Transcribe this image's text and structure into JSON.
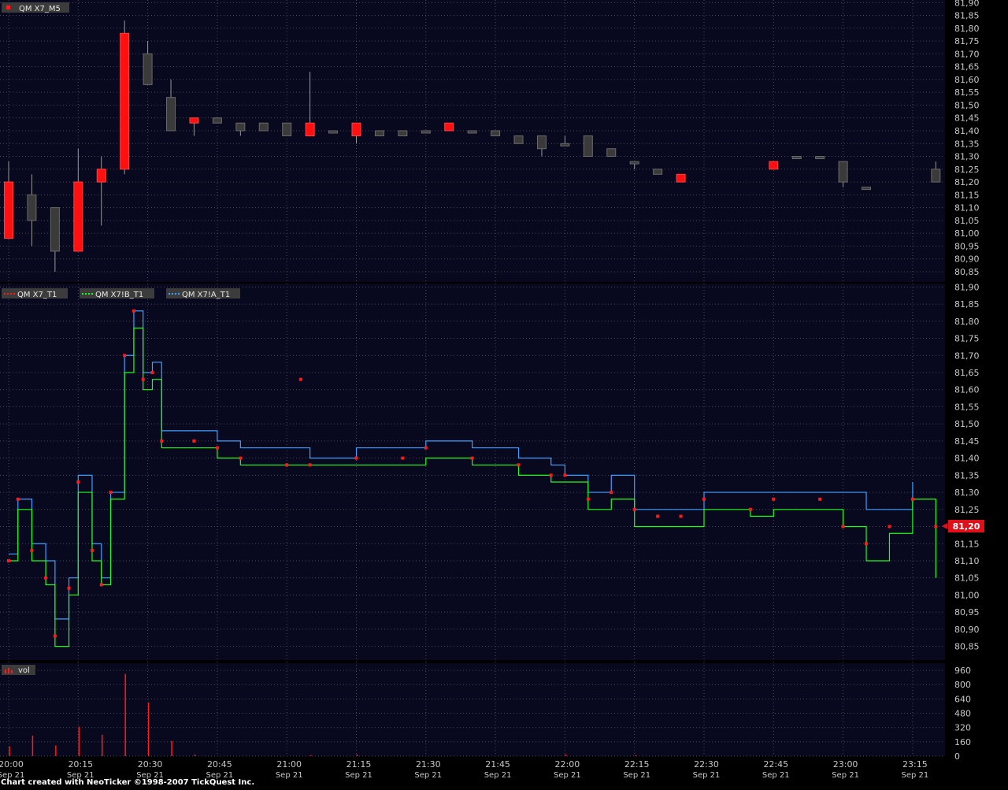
{
  "colors": {
    "background": "#000000",
    "panel": "#08081e",
    "grid": "#4a4a5a",
    "axis_text": "#c8c8c8",
    "up_candle": "#3a3a3a",
    "down_candle": "#ff1010",
    "wick": "#9a9a9a",
    "trade": "#ff1a1a",
    "bid": "#1cff1c",
    "ask": "#3ea0ff",
    "volume": "#ff1a1a",
    "price_marker": "#e0101a"
  },
  "footer": "Chart created with NeoTicker ©1998-2007 TickQuest Inc.",
  "price_marker": {
    "value": "81,20"
  },
  "legends": {
    "candles": "QM X7_M5",
    "trade": "QM X7_T1",
    "bid": "QM X7!B_T1",
    "ask": "QM X7!A_T1",
    "volume": "vol"
  },
  "chart_data": [
    {
      "type": "candlestick",
      "series_name": "QM X7_M5",
      "ylim": [
        80.81,
        81.91
      ],
      "yticks": [
        "81,90",
        "81,85",
        "81,80",
        "81,75",
        "81,70",
        "81,65",
        "81,60",
        "81,55",
        "81,50",
        "81,45",
        "81,40",
        "81,35",
        "81,30",
        "81,25",
        "81,20",
        "81,15",
        "81,10",
        "81,05",
        "81,00",
        "80,95",
        "80,90",
        "80,85"
      ],
      "candles": [
        {
          "t": "20:00",
          "o": 81.2,
          "h": 81.28,
          "l": 80.98,
          "c": 80.98
        },
        {
          "t": "20:05",
          "o": 81.05,
          "h": 81.23,
          "l": 80.95,
          "c": 81.15
        },
        {
          "t": "20:10",
          "o": 80.93,
          "h": 81.1,
          "l": 80.85,
          "c": 81.1
        },
        {
          "t": "20:15",
          "o": 81.2,
          "h": 81.33,
          "l": 80.93,
          "c": 80.93
        },
        {
          "t": "20:20",
          "o": 81.25,
          "h": 81.3,
          "l": 81.03,
          "c": 81.2
        },
        {
          "t": "20:25",
          "o": 81.78,
          "h": 81.83,
          "l": 81.23,
          "c": 81.25
        },
        {
          "t": "20:30",
          "o": 81.58,
          "h": 81.75,
          "l": 81.58,
          "c": 81.7
        },
        {
          "t": "20:35",
          "o": 81.4,
          "h": 81.6,
          "l": 81.4,
          "c": 81.53
        },
        {
          "t": "20:40",
          "o": 81.45,
          "h": 81.45,
          "l": 81.38,
          "c": 81.43
        },
        {
          "t": "20:45",
          "o": 81.43,
          "h": 81.45,
          "l": 81.43,
          "c": 81.45
        },
        {
          "t": "20:50",
          "o": 81.4,
          "h": 81.43,
          "l": 81.38,
          "c": 81.43
        },
        {
          "t": "20:55",
          "o": 81.4,
          "h": 81.43,
          "l": 81.4,
          "c": 81.43
        },
        {
          "t": "21:00",
          "o": 81.38,
          "h": 81.43,
          "l": 81.38,
          "c": 81.43
        },
        {
          "t": "21:05",
          "o": 81.43,
          "h": 81.63,
          "l": 81.38,
          "c": 81.38
        },
        {
          "t": "21:10",
          "o": 81.4,
          "h": 81.4,
          "l": 81.4,
          "c": 81.4
        },
        {
          "t": "21:15",
          "o": 81.43,
          "h": 81.43,
          "l": 81.35,
          "c": 81.38
        },
        {
          "t": "21:20",
          "o": 81.38,
          "h": 81.4,
          "l": 81.38,
          "c": 81.4
        },
        {
          "t": "21:25",
          "o": 81.38,
          "h": 81.4,
          "l": 81.38,
          "c": 81.4
        },
        {
          "t": "21:30",
          "o": 81.4,
          "h": 81.4,
          "l": 81.4,
          "c": 81.4
        },
        {
          "t": "21:35",
          "o": 81.43,
          "h": 81.43,
          "l": 81.4,
          "c": 81.4
        },
        {
          "t": "21:40",
          "o": 81.4,
          "h": 81.4,
          "l": 81.4,
          "c": 81.4
        },
        {
          "t": "21:45",
          "o": 81.38,
          "h": 81.4,
          "l": 81.38,
          "c": 81.4
        },
        {
          "t": "21:50",
          "o": 81.35,
          "h": 81.38,
          "l": 81.35,
          "c": 81.38
        },
        {
          "t": "21:55",
          "o": 81.33,
          "h": 81.38,
          "l": 81.3,
          "c": 81.38
        },
        {
          "t": "22:00",
          "o": 81.35,
          "h": 81.38,
          "l": 81.35,
          "c": 81.35
        },
        {
          "t": "22:05",
          "o": 81.3,
          "h": 81.38,
          "l": 81.3,
          "c": 81.38
        },
        {
          "t": "22:10",
          "o": 81.3,
          "h": 81.33,
          "l": 81.3,
          "c": 81.33
        },
        {
          "t": "22:15",
          "o": 81.28,
          "h": 81.28,
          "l": 81.25,
          "c": 81.28
        },
        {
          "t": "22:20",
          "o": 81.23,
          "h": 81.25,
          "l": 81.23,
          "c": 81.25
        },
        {
          "t": "22:25",
          "o": 81.23,
          "h": 81.23,
          "l": 81.2,
          "c": 81.2
        },
        {
          "t": "22:45",
          "o": 81.28,
          "h": 81.28,
          "l": 81.25,
          "c": 81.25
        },
        {
          "t": "22:50",
          "o": 81.3,
          "h": 81.3,
          "l": 81.3,
          "c": 81.3
        },
        {
          "t": "22:55",
          "o": 81.3,
          "h": 81.3,
          "l": 81.3,
          "c": 81.3
        },
        {
          "t": "23:00",
          "o": 81.2,
          "h": 81.28,
          "l": 81.18,
          "c": 81.28
        },
        {
          "t": "23:05",
          "o": 81.18,
          "h": 81.18,
          "l": 81.18,
          "c": 81.18
        },
        {
          "t": "23:20",
          "o": 81.2,
          "h": 81.28,
          "l": 81.2,
          "c": 81.25
        }
      ]
    },
    {
      "type": "line",
      "ylim": [
        80.81,
        81.91
      ],
      "yticks": [
        "81,90",
        "81,85",
        "81,80",
        "81,75",
        "81,70",
        "81,65",
        "81,60",
        "81,55",
        "81,50",
        "81,45",
        "81,40",
        "81,35",
        "81,30",
        "81,25",
        "81,20",
        "81,15",
        "81,10",
        "81,05",
        "81,00",
        "80,95",
        "80,90",
        "80,85"
      ],
      "series": [
        {
          "name": "QM X7!A_T1",
          "points": [
            [
              "20:00",
              81.12
            ],
            [
              "20:02",
              81.28
            ],
            [
              "20:05",
              81.15
            ],
            [
              "20:08",
              81.1
            ],
            [
              "20:10",
              80.93
            ],
            [
              "20:13",
              81.05
            ],
            [
              "20:15",
              81.35
            ],
            [
              "20:18",
              81.15
            ],
            [
              "20:20",
              81.05
            ],
            [
              "20:22",
              81.3
            ],
            [
              "20:25",
              81.7
            ],
            [
              "20:27",
              81.83
            ],
            [
              "20:29",
              81.65
            ],
            [
              "20:31",
              81.68
            ],
            [
              "20:33",
              81.48
            ],
            [
              "20:40",
              81.48
            ],
            [
              "20:45",
              81.45
            ],
            [
              "20:50",
              81.43
            ],
            [
              "21:00",
              81.43
            ],
            [
              "21:05",
              81.4
            ],
            [
              "21:15",
              81.43
            ],
            [
              "21:25",
              81.43
            ],
            [
              "21:30",
              81.45
            ],
            [
              "21:40",
              81.43
            ],
            [
              "21:50",
              81.4
            ],
            [
              "21:57",
              81.38
            ],
            [
              "22:00",
              81.35
            ],
            [
              "22:05",
              81.3
            ],
            [
              "22:10",
              81.35
            ],
            [
              "22:15",
              81.25
            ],
            [
              "22:20",
              81.25
            ],
            [
              "22:25",
              81.25
            ],
            [
              "22:30",
              81.3
            ],
            [
              "22:40",
              81.3
            ],
            [
              "22:45",
              81.3
            ],
            [
              "22:55",
              81.3
            ],
            [
              "23:00",
              81.3
            ],
            [
              "23:05",
              81.25
            ],
            [
              "23:10",
              81.25
            ],
            [
              "23:15",
              81.33
            ]
          ]
        },
        {
          "name": "QM X7!B_T1",
          "points": [
            [
              "20:00",
              81.1
            ],
            [
              "20:02",
              81.25
            ],
            [
              "20:05",
              81.1
            ],
            [
              "20:08",
              81.03
            ],
            [
              "20:10",
              80.85
            ],
            [
              "20:13",
              81.0
            ],
            [
              "20:15",
              81.3
            ],
            [
              "20:18",
              81.1
            ],
            [
              "20:20",
              81.03
            ],
            [
              "20:22",
              81.28
            ],
            [
              "20:25",
              81.65
            ],
            [
              "20:27",
              81.78
            ],
            [
              "20:29",
              81.6
            ],
            [
              "20:31",
              81.63
            ],
            [
              "20:33",
              81.43
            ],
            [
              "20:40",
              81.43
            ],
            [
              "20:45",
              81.4
            ],
            [
              "20:50",
              81.38
            ],
            [
              "21:00",
              81.38
            ],
            [
              "21:05",
              81.38
            ],
            [
              "21:15",
              81.38
            ],
            [
              "21:25",
              81.38
            ],
            [
              "21:30",
              81.4
            ],
            [
              "21:40",
              81.38
            ],
            [
              "21:50",
              81.35
            ],
            [
              "21:57",
              81.33
            ],
            [
              "22:00",
              81.33
            ],
            [
              "22:05",
              81.25
            ],
            [
              "22:10",
              81.28
            ],
            [
              "22:15",
              81.2
            ],
            [
              "22:20",
              81.2
            ],
            [
              "22:25",
              81.2
            ],
            [
              "22:30",
              81.25
            ],
            [
              "22:40",
              81.23
            ],
            [
              "22:45",
              81.25
            ],
            [
              "22:55",
              81.25
            ],
            [
              "23:00",
              81.2
            ],
            [
              "23:05",
              81.1
            ],
            [
              "23:10",
              81.18
            ],
            [
              "23:15",
              81.28
            ],
            [
              "23:20",
              81.05
            ]
          ]
        },
        {
          "name": "QM X7_T1",
          "points": [
            [
              "20:00",
              81.1
            ],
            [
              "20:02",
              81.28
            ],
            [
              "20:05",
              81.13
            ],
            [
              "20:08",
              81.05
            ],
            [
              "20:10",
              80.88
            ],
            [
              "20:13",
              81.02
            ],
            [
              "20:15",
              81.33
            ],
            [
              "20:18",
              81.13
            ],
            [
              "20:20",
              81.03
            ],
            [
              "20:22",
              81.3
            ],
            [
              "20:25",
              81.7
            ],
            [
              "20:27",
              81.83
            ],
            [
              "20:29",
              81.63
            ],
            [
              "20:31",
              81.65
            ],
            [
              "20:33",
              81.45
            ],
            [
              "20:40",
              81.45
            ],
            [
              "20:45",
              81.43
            ],
            [
              "20:50",
              81.4
            ],
            [
              "21:00",
              81.38
            ],
            [
              "21:03",
              81.63
            ],
            [
              "21:05",
              81.38
            ],
            [
              "21:15",
              81.4
            ],
            [
              "21:25",
              81.4
            ],
            [
              "21:30",
              81.43
            ],
            [
              "21:40",
              81.4
            ],
            [
              "21:50",
              81.38
            ],
            [
              "21:57",
              81.35
            ],
            [
              "22:00",
              81.35
            ],
            [
              "22:05",
              81.28
            ],
            [
              "22:10",
              81.3
            ],
            [
              "22:15",
              81.25
            ],
            [
              "22:20",
              81.23
            ],
            [
              "22:25",
              81.23
            ],
            [
              "22:30",
              81.28
            ],
            [
              "22:40",
              81.25
            ],
            [
              "22:45",
              81.28
            ],
            [
              "22:55",
              81.28
            ],
            [
              "23:00",
              81.2
            ],
            [
              "23:05",
              81.15
            ],
            [
              "23:10",
              81.2
            ],
            [
              "23:15",
              81.28
            ],
            [
              "23:20",
              81.2
            ]
          ]
        }
      ]
    },
    {
      "type": "bar",
      "series_name": "vol",
      "ylim": [
        0,
        1040
      ],
      "yticks": [
        "960",
        "800",
        "640",
        "480",
        "320",
        "160",
        "0"
      ],
      "points": [
        [
          "20:00",
          110
        ],
        [
          "20:05",
          230
        ],
        [
          "20:10",
          120
        ],
        [
          "20:15",
          330
        ],
        [
          "20:20",
          240
        ],
        [
          "20:25",
          920
        ],
        [
          "20:30",
          600
        ],
        [
          "20:35",
          170
        ],
        [
          "20:40",
          20
        ],
        [
          "21:05",
          10
        ],
        [
          "21:15",
          20
        ],
        [
          "22:00",
          20
        ],
        [
          "22:15",
          10
        ]
      ]
    }
  ],
  "xaxis": {
    "ticks": [
      {
        "time": "20:00",
        "date": "Sep 21"
      },
      {
        "time": "20:15",
        "date": "Sep 21"
      },
      {
        "time": "20:30",
        "date": "Sep 21"
      },
      {
        "time": "20:45",
        "date": "Sep 21"
      },
      {
        "time": "21:00",
        "date": "Sep 21"
      },
      {
        "time": "21:15",
        "date": "Sep 21"
      },
      {
        "time": "21:30",
        "date": "Sep 21"
      },
      {
        "time": "21:45",
        "date": "Sep 21"
      },
      {
        "time": "22:00",
        "date": "Sep 21"
      },
      {
        "time": "22:15",
        "date": "Sep 21"
      },
      {
        "time": "22:30",
        "date": "Sep 21"
      },
      {
        "time": "22:45",
        "date": "Sep 21"
      },
      {
        "time": "23:00",
        "date": "Sep 21"
      },
      {
        "time": "23:15",
        "date": "Sep 21"
      }
    ]
  }
}
